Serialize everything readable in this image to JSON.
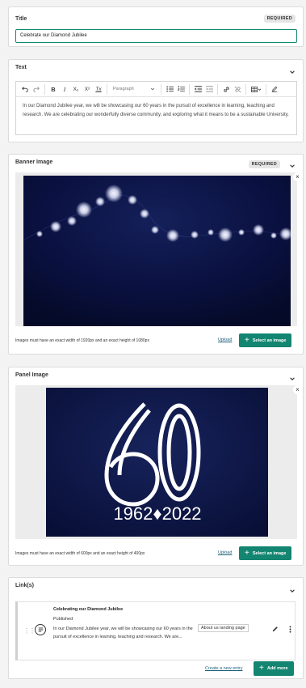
{
  "title_card": {
    "label": "Title",
    "badge": "REQUIRED",
    "value": "Celebrate our Diamond Jubilee"
  },
  "text_card": {
    "label": "Text",
    "format_select": "Paragraph",
    "toolbar": {
      "bold": "B",
      "italic": "I",
      "subscript": "X₂",
      "superscript": "X²",
      "clear_format": "Tx"
    },
    "body": "In our Diamond Jubilee year, we will be showcasing our 60 years in the pursuit of excellence in learning, teaching and research. We are celebrating our wonderfully diverse community, and exploring what it means to be a sustainable University."
  },
  "banner_card": {
    "label": "Banner Image",
    "badge": "REQUIRED",
    "hint": "Images must have an exact width of 1920px and an exact height of 1080px",
    "upload": "Upload",
    "select": "Select an image"
  },
  "panel_card": {
    "label": "Panel Image",
    "hint": "Images must have an exact width of 600px and an exact height of 400px",
    "upload": "Upload",
    "select": "Select an image",
    "image_years": "1962♦2022"
  },
  "links_card": {
    "label": "Link(s)",
    "entry": {
      "title": "Celebrating our Diamond Jubilee",
      "status": "Published",
      "description": "In our Diamond Jubilee year, we will be showcasing our 60 years in the pursuit of excellence in learning, teaching and research. We are...",
      "tag": "About us landing page"
    },
    "create_link": "Create a new entry",
    "add_more": "Add more"
  },
  "colors": {
    "accent": "#138571",
    "focus_border": "#128a6f"
  }
}
